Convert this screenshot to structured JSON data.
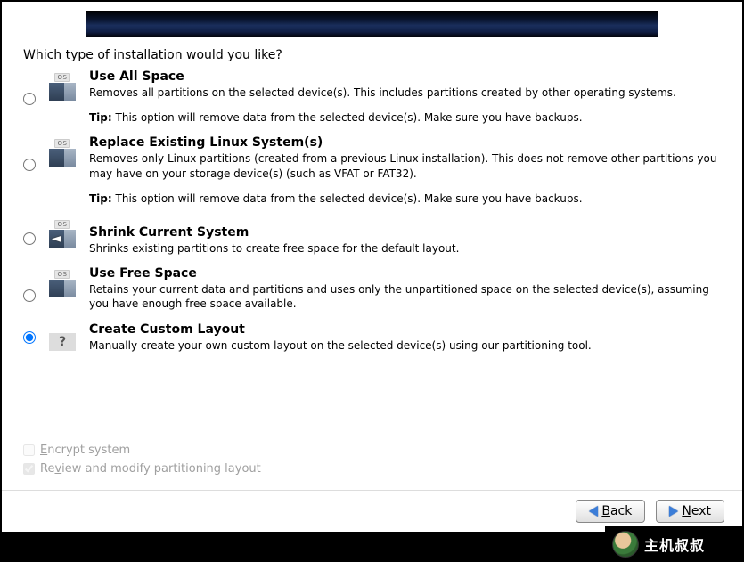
{
  "prompt": "Which type of installation would you like?",
  "options": [
    {
      "title": "Use All Space",
      "desc": "Removes all partitions on the selected device(s).  This includes partitions created by other operating systems.",
      "tip_label": "Tip:",
      "tip": " This option will remove data from the selected device(s).  Make sure you have backups.",
      "os_tag": "OS"
    },
    {
      "title": "Replace Existing Linux System(s)",
      "desc": "Removes only Linux partitions (created from a previous Linux installation).  This does not remove other partitions you may have on your storage device(s) (such as VFAT or FAT32).",
      "tip_label": "Tip:",
      "tip": " This option will remove data from the selected device(s).  Make sure you have backups.",
      "os_tag": "OS"
    },
    {
      "title": "Shrink Current System",
      "desc": "Shrinks existing partitions to create free space for the default layout.",
      "os_tag": "OS"
    },
    {
      "title": "Use Free Space",
      "desc": "Retains your current data and partitions and uses only the unpartitioned space on the selected device(s), assuming you have enough free space available.",
      "os_tag": "OS"
    },
    {
      "title": "Create Custom Layout",
      "desc": "Manually create your own custom layout on the selected device(s) using our partitioning tool."
    }
  ],
  "checkboxes": {
    "encrypt_pre": "E",
    "encrypt_post": "ncrypt system",
    "review_pre": "Re",
    "review_mid": "v",
    "review_post": "iew and modify partitioning layout"
  },
  "buttons": {
    "back_pre": "B",
    "back_post": "ack",
    "next_pre": "N",
    "next_post": "ext"
  },
  "watermark": "主机叔叔"
}
